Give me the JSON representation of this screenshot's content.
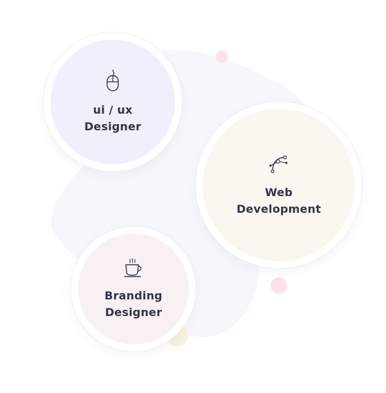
{
  "colors": {
    "blob": "#f5f6f9",
    "uiux_bg": "#f0f0fc",
    "web_bg": "#f9f7f0",
    "branding_bg": "#f9f0f3",
    "accent_pink_dot": "#fbe3e8",
    "accent_yellow_dot": "#f6f0df",
    "text": "#333548"
  },
  "services": [
    {
      "icon": "mouse-icon",
      "label_line1": "ui / ux",
      "label_line2": "Designer"
    },
    {
      "icon": "bezier-pen-icon",
      "label_line1": "Web",
      "label_line2": "Development"
    },
    {
      "icon": "coffee-cup-icon",
      "label_line1": "Branding",
      "label_line2": "Designer"
    }
  ]
}
